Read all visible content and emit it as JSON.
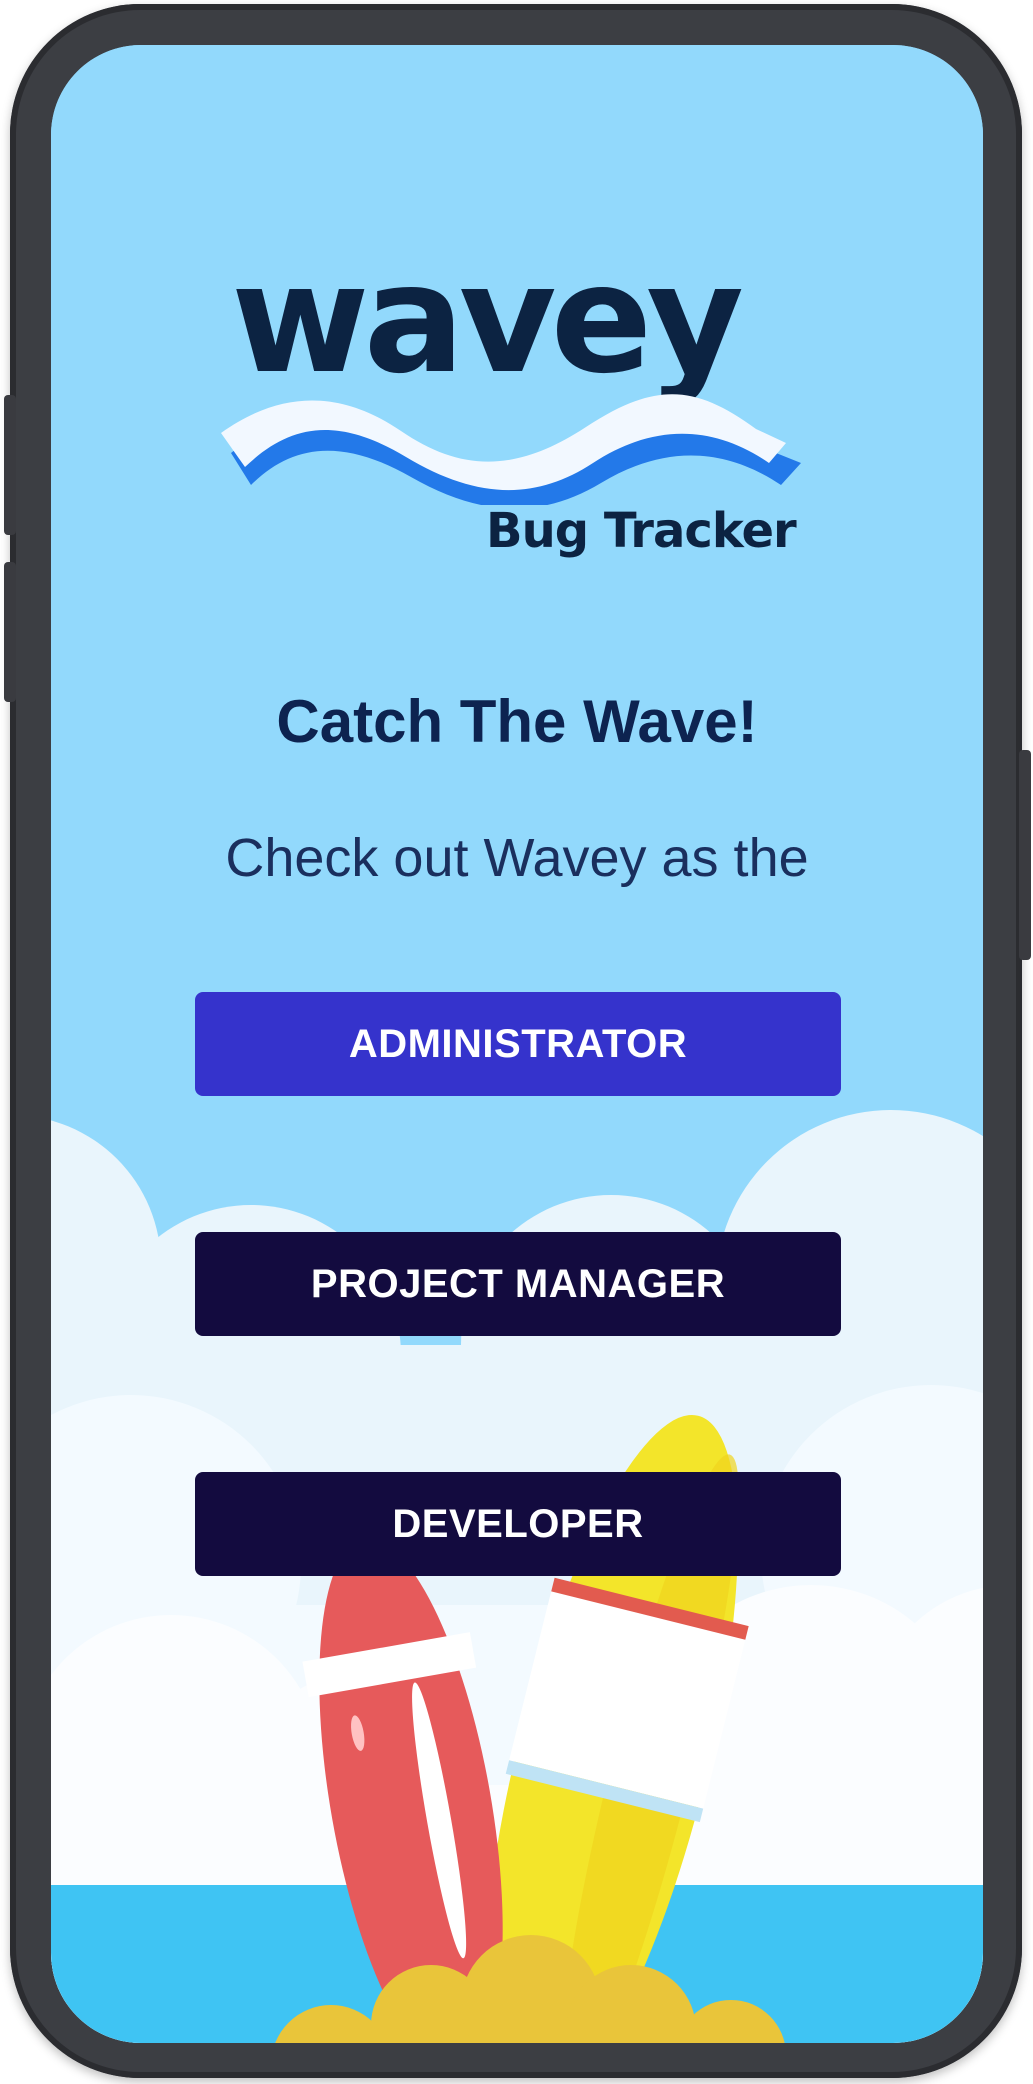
{
  "logo": {
    "word": "wavey",
    "subtitle": "Bug Tracker"
  },
  "hero": {
    "headline": "Catch The Wave!",
    "subhead": "Check out Wavey as the"
  },
  "roles": {
    "administrator": "ADMINISTRATOR",
    "project_manager": "PROJECT MANAGER",
    "developer": "DEVELOPER"
  },
  "colors": {
    "sky": "#92d9fc",
    "navy_text": "#0c2342",
    "admin_button": "#3533cc",
    "dark_button": "#130b3f",
    "ocean": "#3fc4f3",
    "phone_frame": "#3c3e43"
  },
  "icons": [
    "surfboard-red-illustration",
    "surfboard-yellow-illustration",
    "cloud-illustration",
    "wave-logo-mark"
  ]
}
